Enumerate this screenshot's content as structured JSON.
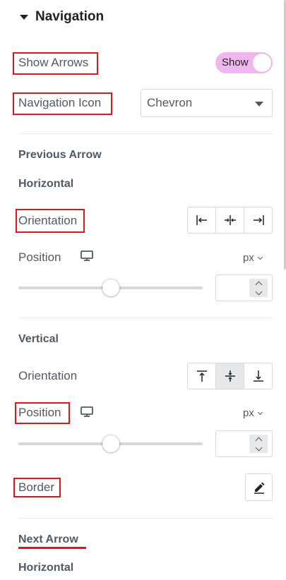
{
  "section": {
    "title": "Navigation"
  },
  "show_arrows": {
    "label": "Show Arrows",
    "toggle_text": "Show",
    "enabled": true
  },
  "navigation_icon": {
    "label": "Navigation Icon",
    "value": "Chevron"
  },
  "previous_arrow": {
    "heading": "Previous Arrow",
    "horizontal": {
      "heading": "Horizontal",
      "orientation_label": "Orientation",
      "orientation_options": [
        "align-left-icon",
        "align-center-icon",
        "align-right-icon"
      ],
      "position_label": "Position",
      "device_icon": "desktop-icon",
      "unit": "px",
      "slider_level": 0.5,
      "input_value": ""
    },
    "vertical": {
      "heading": "Vertical",
      "orientation_label": "Orientation",
      "orientation_options": [
        "align-top-icon",
        "align-middle-icon",
        "align-bottom-icon"
      ],
      "selected_option": 1,
      "position_label": "Position",
      "device_icon": "desktop-icon",
      "unit": "px",
      "slider_level": 0.5,
      "input_value": ""
    },
    "border_label": "Border",
    "border_edit_icon": "pencil-icon"
  },
  "next_arrow": {
    "heading": "Next Arrow",
    "horizontal_heading": "Horizontal"
  },
  "colors": {
    "highlight": "#e0151b",
    "toggle_bg": "#f0b7ee",
    "text": "#515962"
  }
}
